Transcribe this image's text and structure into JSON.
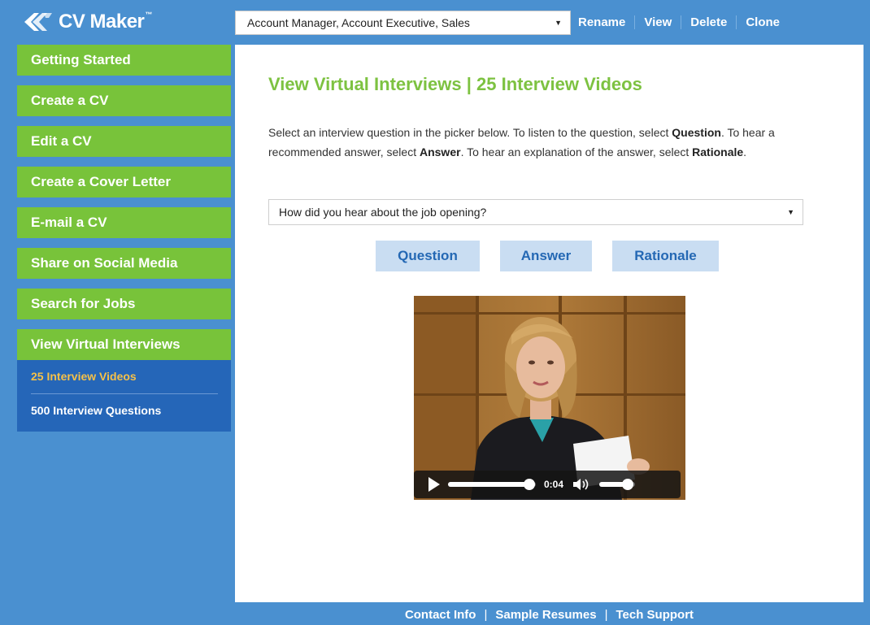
{
  "app": {
    "logo_text": "CV Maker",
    "logo_tm": "™"
  },
  "header": {
    "resume_select_value": "Account Manager, Account Executive, Sales",
    "actions": [
      "Rename",
      "View",
      "Delete",
      "Clone"
    ]
  },
  "sidebar": {
    "items": [
      {
        "label": "Getting Started"
      },
      {
        "label": "Create a CV"
      },
      {
        "label": "Edit a CV"
      },
      {
        "label": "Create a Cover Letter"
      },
      {
        "label": "E-mail a CV"
      },
      {
        "label": "Share on Social Media"
      },
      {
        "label": "Search for Jobs"
      },
      {
        "label": "View Virtual Interviews"
      }
    ],
    "subitems": [
      {
        "label": "25 Interview Videos"
      },
      {
        "label": "500 Interview Questions"
      }
    ]
  },
  "main": {
    "title": "View Virtual Interviews | 25 Interview Videos",
    "intro_1": "Select an interview question in the picker below. To listen to the question, select ",
    "intro_b1": "Question",
    "intro_2": ". To hear a recommended answer, select ",
    "intro_b2": "Answer",
    "intro_3": ". To hear an explanation of the answer, select ",
    "intro_b3": "Rationale",
    "intro_4": ".",
    "question_select_value": "How did you hear about the job opening?",
    "buttons": {
      "question": "Question",
      "answer": "Answer",
      "rationale": "Rationale"
    },
    "video": {
      "time": "0:04",
      "progress_fraction": 0.93,
      "volume_fraction": 0.8
    }
  },
  "footer": {
    "links": [
      "Contact Info",
      "Sample Resumes",
      "Tech Support"
    ],
    "separator": "|"
  },
  "colors": {
    "page_bg": "#4a90d0",
    "nav_green": "#78c33a",
    "title_green": "#7dc241",
    "subnav_blue": "#2566b8",
    "selected_subnav": "#f6c148",
    "button_bg": "#c9ddf2",
    "button_text": "#2468b4"
  }
}
